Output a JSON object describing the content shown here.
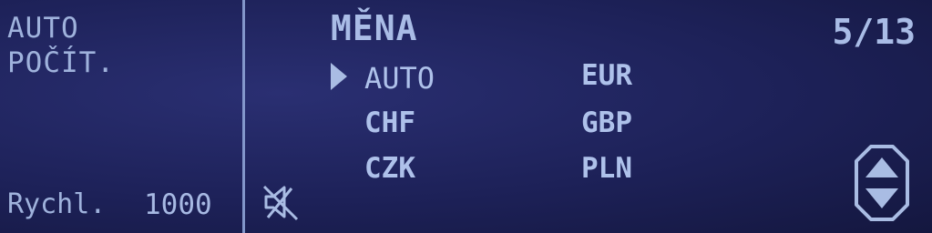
{
  "mode": {
    "line1": "AUTO",
    "line2": "POČÍT."
  },
  "speed": {
    "label": "Rychl.",
    "value": "1000"
  },
  "menu": {
    "title": "MĚNA",
    "page": "5/13",
    "selected": "AUTO",
    "options": {
      "auto": "AUTO",
      "eur": "EUR",
      "chf": "CHF",
      "gbp": "GBP",
      "czk": "CZK",
      "pln": "PLN"
    }
  },
  "icons": {
    "cursor": "triangle-pointer-icon",
    "mute": "speaker-muted-icon",
    "scroll": "up-down-arrows-icon"
  },
  "colors": {
    "background": "#1d2158",
    "text": "#a9bce3"
  }
}
